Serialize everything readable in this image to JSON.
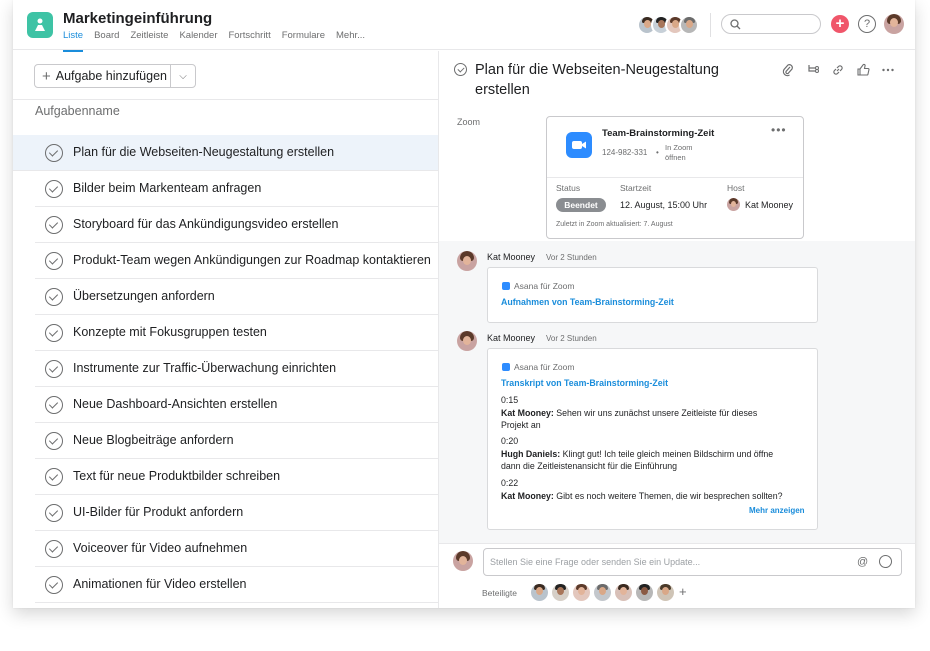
{
  "header": {
    "project_title": "Marketingeinführung",
    "tabs": [
      {
        "label": "Liste",
        "active": true
      },
      {
        "label": "Board",
        "active": false
      },
      {
        "label": "Zeitleiste",
        "active": false
      },
      {
        "label": "Kalender",
        "active": false
      },
      {
        "label": "Fortschritt",
        "active": false
      },
      {
        "label": "Formulare",
        "active": false
      },
      {
        "label": "Mehr...",
        "active": false
      }
    ],
    "search_placeholder": "",
    "accent_color": "#1a8ddb",
    "add_button_color": "#f0566a"
  },
  "task_list": {
    "add_task_label": "Aufgabe hinzufügen",
    "column_header": "Aufgabenname",
    "tasks": [
      "Plan für die Webseiten-Neugestaltung erstellen",
      "Bilder beim Markenteam anfragen",
      "Storyboard für das Ankündigungsvideo erstellen",
      "Produkt-Team wegen Ankündigungen zur Roadmap kontaktieren",
      "Übersetzungen anfordern",
      "Konzepte mit Fokusgruppen testen",
      "Instrumente zur Traffic-Überwachung einrichten",
      "Neue Dashboard-Ansichten erstellen",
      "Neue Blogbeiträge anfordern",
      "Text für neue Produktbilder schreiben",
      "UI-Bilder für Produkt anfordern",
      "Voiceover für Video aufnehmen",
      "Animationen für Video erstellen"
    ]
  },
  "detail": {
    "title": "Plan für die Webseiten-Neugestaltung erstellen",
    "zoom_field_label": "Zoom",
    "zoom_card": {
      "title": "Team-Brainstorming-Zeit",
      "meeting_id": "124-982-331",
      "open_in_zoom": "In Zoom öffnen",
      "status_label": "Status",
      "status_value": "Beendet",
      "start_label": "Startzeit",
      "start_value": "12. August, 15:00 Uhr",
      "host_label": "Host",
      "host_value": "Kat Mooney",
      "last_updated": "Zuletzt in Zoom aktualisiert: 7. August"
    },
    "activity": [
      {
        "author": "Kat Mooney",
        "time": "Vor 2 Stunden",
        "source": "Asana für Zoom",
        "link": "Aufnahmen von Team-Brainstorming-Zeit"
      },
      {
        "author": "Kat Mooney",
        "time": "Vor 2 Stunden",
        "source": "Asana für Zoom",
        "link": "Transkript von Team-Brainstorming-Zeit",
        "transcript": [
          {
            "ts": "0:15",
            "speaker": "Kat Mooney:",
            "line1": "Sehen wir uns zunächst unsere Zeitleiste für dieses",
            "line2": "Projekt an"
          },
          {
            "ts": "0:20",
            "speaker": "Hugh Daniels:",
            "line1": "Klingt gut! Ich teile gleich meinen Bildschirm und öffne",
            "line2": "dann die Zeitleistenansicht für die Einführung"
          },
          {
            "ts": "0:22",
            "speaker": "Kat Mooney:",
            "line1": "Gibt es noch weitere Themen, die wir besprechen sollten?",
            "line2": ""
          }
        ],
        "show_more": "Mehr anzeigen"
      }
    ],
    "composer_placeholder": "Stellen Sie eine Frage oder senden Sie ein Update...",
    "collaborators_label": "Beteiligte"
  }
}
